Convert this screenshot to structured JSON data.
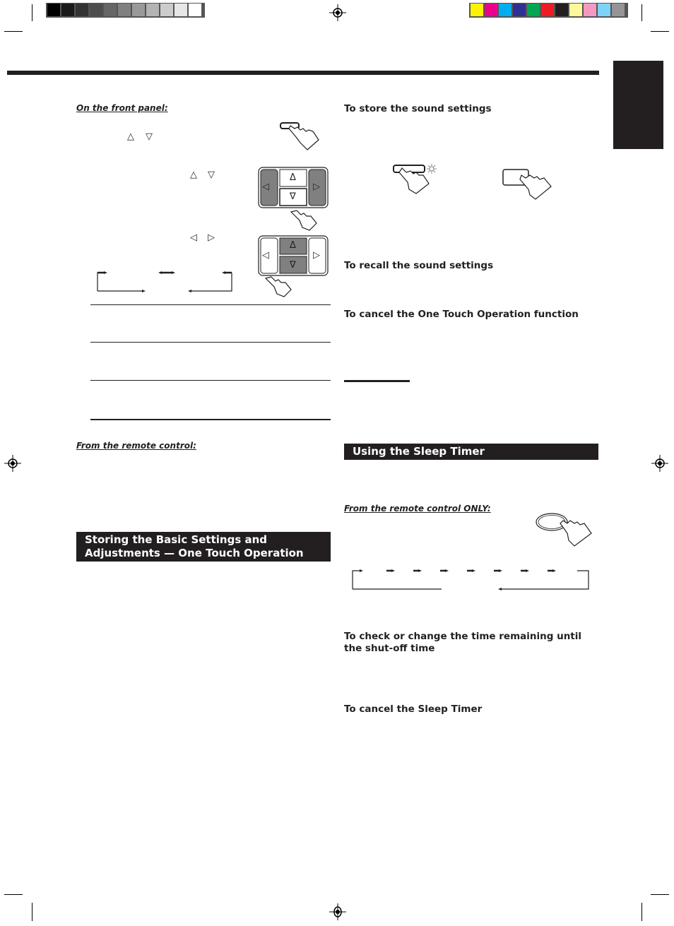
{
  "print_marks": {
    "grayscale_swatches": [
      "#000000",
      "#1a1a1a",
      "#333333",
      "#4d4d4d",
      "#666666",
      "#808080",
      "#999999",
      "#b3b3b3",
      "#cccccc",
      "#e6e6e6",
      "#ffffff"
    ],
    "color_swatches": [
      "#fff200",
      "#ec008c",
      "#00aeef",
      "#2e3192",
      "#00a651",
      "#ed1c24",
      "#231f20",
      "#fff799",
      "#f49ac2",
      "#7dd3f7",
      "#959595"
    ]
  },
  "left_column": {
    "front_panel_heading": "On the front panel:",
    "step1_arrows": [
      "△",
      "▽"
    ],
    "step2_arrows": [
      "△",
      "▽"
    ],
    "step3_arrows": [
      "◁",
      "▷"
    ],
    "remote_heading": "From the remote control:",
    "banner_line1": "Storing the Basic Settings and",
    "banner_line2": "Adjustments — One Touch Operation"
  },
  "cursor_pad": {
    "up": "Δ",
    "down": "∇",
    "left": "◁",
    "right": "▷"
  },
  "right_column": {
    "store_heading": "To store the sound settings",
    "recall_heading": "To recall the sound settings",
    "cancel_one_touch_heading": "To cancel the One Touch Operation function",
    "sleep_banner": "Using the Sleep Timer",
    "remote_only_heading": "From the remote control ONLY:",
    "check_time_heading": "To check or change the time remaining until the shut-off time",
    "cancel_sleep_heading": "To cancel the Sleep Timer"
  },
  "colors": {
    "ink": "#231f20",
    "pad_shade": "#808080"
  }
}
